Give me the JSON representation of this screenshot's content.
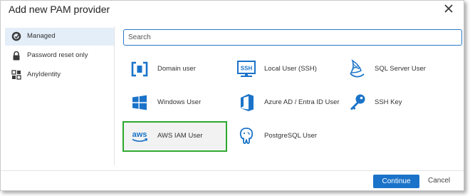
{
  "dialog": {
    "title": "Add new PAM provider",
    "close_icon": "close-icon"
  },
  "sidebar": {
    "items": [
      {
        "label": "Managed",
        "icon": "managed-icon",
        "active": true
      },
      {
        "label": "Password reset only",
        "icon": "lock-icon",
        "active": false
      },
      {
        "label": "AnyIdentity",
        "icon": "grid-icon",
        "active": false
      }
    ]
  },
  "search": {
    "placeholder": "Search",
    "value": ""
  },
  "providers": [
    {
      "label": "Domain user",
      "icon": "domain-user-icon"
    },
    {
      "label": "Local User (SSH)",
      "icon": "ssh-terminal-icon"
    },
    {
      "label": "SQL Server User",
      "icon": "sql-server-icon"
    },
    {
      "label": "Windows User",
      "icon": "windows-logo-icon"
    },
    {
      "label": "Azure AD / Entra ID User",
      "icon": "office-logo-icon"
    },
    {
      "label": "SSH Key",
      "icon": "ssh-key-icon"
    },
    {
      "label": "AWS IAM User",
      "icon": "aws-logo-icon",
      "selected": true
    },
    {
      "label": "PostgreSQL User",
      "icon": "postgresql-icon"
    }
  ],
  "footer": {
    "continue_label": "Continue",
    "cancel_label": "Cancel"
  },
  "colors": {
    "accent": "#1a73c9",
    "selection_highlight": "#2ea82e",
    "sidebar_active": "#e3eef8"
  }
}
